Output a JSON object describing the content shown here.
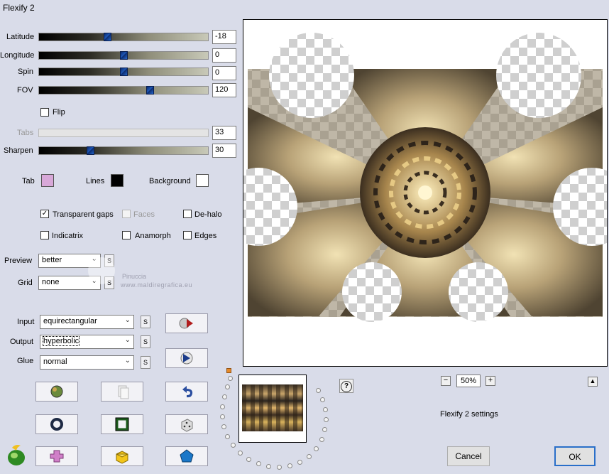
{
  "window": {
    "title": "Flexify 2"
  },
  "sliders": [
    {
      "label": "Latitude",
      "value": "-18",
      "level": 0.4
    },
    {
      "label": "Longitude",
      "value": "0",
      "level": 0.5
    },
    {
      "label": "Spin",
      "value": "0",
      "level": 0.5
    },
    {
      "label": "FOV",
      "value": "120",
      "level": 0.66
    }
  ],
  "flip": {
    "label": "Flip",
    "checked": false
  },
  "tabs": {
    "label": "Tabs",
    "value": "33"
  },
  "sharpen": {
    "label": "Sharpen",
    "value": "30",
    "level": 0.3
  },
  "colors": {
    "tab_label": "Tab",
    "tab_color": "#d8a8d8",
    "lines_label": "Lines",
    "lines_color": "#000000",
    "background_label": "Background",
    "background_color": "#ffffff"
  },
  "options": {
    "transparent_gaps": "Transparent gaps",
    "faces": "Faces",
    "de_halo": "De-halo",
    "indicatrix": "Indicatrix",
    "anamorph": "Anamorph",
    "edges": "Edges"
  },
  "preview": {
    "label": "Preview",
    "value": "better"
  },
  "grid": {
    "label": "Grid",
    "value": "none"
  },
  "watermark": {
    "line1": "Pinuccia",
    "line2": "www.maldiregrafica.eu"
  },
  "input": {
    "label": "Input",
    "value": "equirectangular"
  },
  "output": {
    "label": "Output",
    "value": "hyperbolic"
  },
  "glue": {
    "label": "Glue",
    "value": "normal"
  },
  "s_label": "S",
  "zoom": {
    "minus": "−",
    "value": "50%",
    "plus": "+"
  },
  "help": "?",
  "collapse": "▲",
  "settings_label": "Flexify 2 settings",
  "buttons": {
    "cancel": "Cancel",
    "ok": "OK"
  }
}
